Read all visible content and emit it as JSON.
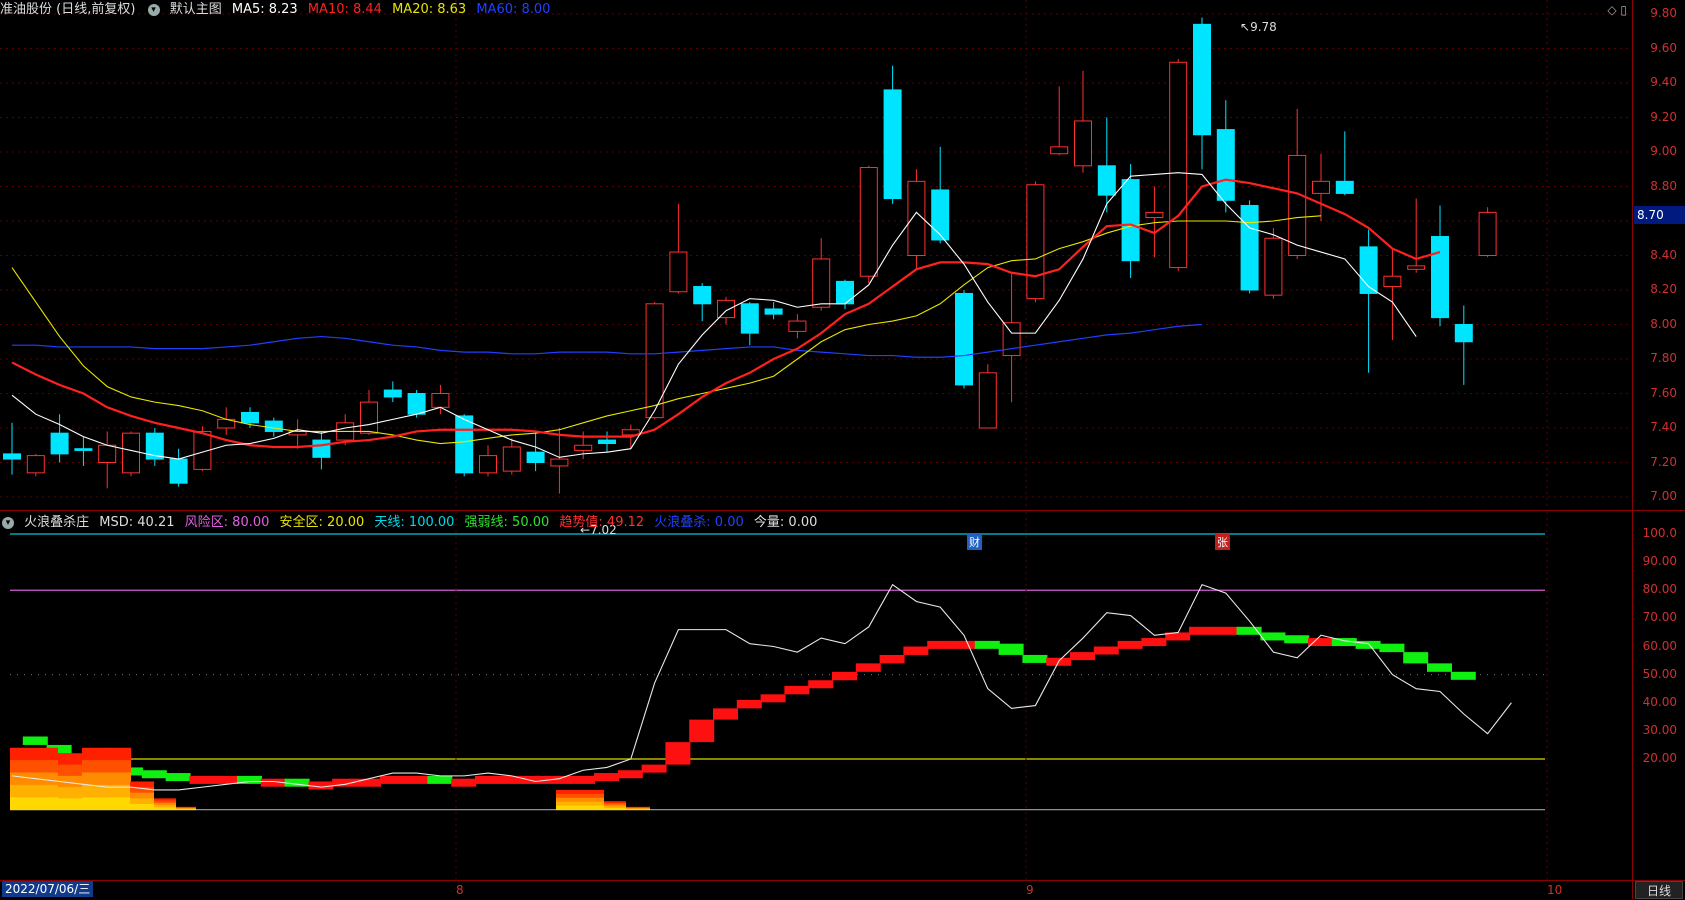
{
  "main_panel": {
    "stock_name": "准油股份 (日线,前复权)",
    "template_label": "默认主图",
    "ma5": "MA5: 8.23",
    "ma10": "MA10: 8.44",
    "ma20": "MA20: 8.63",
    "ma60": "MA60: 8.00",
    "high_marker": "9.78",
    "low_marker": "7.02",
    "event_badge_1": "财",
    "event_badge_2": "张",
    "price_box": "8.70",
    "price_axis_ticks": [
      "9.80",
      "9.60",
      "9.40",
      "9.20",
      "9.00",
      "8.80",
      "8.60",
      "8.40",
      "8.20",
      "8.00",
      "7.80",
      "7.60",
      "7.40",
      "7.20",
      "7.00"
    ],
    "colors": {
      "up": "#ff3030",
      "down": "#00e5ff",
      "ma5": "#ffffff",
      "ma10": "#ff2020",
      "ma20": "#e6e600",
      "ma60": "#2040ff"
    }
  },
  "indicator_panel": {
    "name": "火浪叠杀庄",
    "msd": "MSD: 40.21",
    "risk_zone": "风险区: 80.00",
    "safe_zone": "安全区: 20.00",
    "sky_line": "天线: 100.00",
    "strong_weak": "强弱线: 50.00",
    "trend_value": "趋势值: 49.12",
    "wave_kill": "火浪叠杀: 0.00",
    "volume": "今量: 0.00",
    "axis_ticks": [
      "100.0",
      "90.00",
      "80.00",
      "70.00",
      "60.00",
      "50.00",
      "40.00",
      "30.00",
      "20.00"
    ]
  },
  "bottom_bar": {
    "date": "2022/07/06/三",
    "month_8": "8",
    "month_9": "9",
    "month_10": "10",
    "period": "日线"
  },
  "chart_data": {
    "type": "candlestick",
    "ylim": [
      7.0,
      9.8
    ],
    "candles": [
      {
        "o": 7.25,
        "c": 7.22,
        "h": 7.43,
        "l": 7.13
      },
      {
        "o": 7.14,
        "c": 7.24,
        "h": 7.25,
        "l": 7.12
      },
      {
        "o": 7.37,
        "c": 7.25,
        "h": 7.48,
        "l": 7.2
      },
      {
        "o": 7.28,
        "c": 7.27,
        "h": 7.35,
        "l": 7.18
      },
      {
        "o": 7.2,
        "c": 7.3,
        "h": 7.38,
        "l": 7.05
      },
      {
        "o": 7.14,
        "c": 7.37,
        "h": 7.38,
        "l": 7.12
      },
      {
        "o": 7.37,
        "c": 7.22,
        "h": 7.4,
        "l": 7.18
      },
      {
        "o": 7.22,
        "c": 7.08,
        "h": 7.28,
        "l": 7.06
      },
      {
        "o": 7.16,
        "c": 7.38,
        "h": 7.41,
        "l": 7.15
      },
      {
        "o": 7.4,
        "c": 7.45,
        "h": 7.52,
        "l": 7.36
      },
      {
        "o": 7.49,
        "c": 7.43,
        "h": 7.52,
        "l": 7.4
      },
      {
        "o": 7.44,
        "c": 7.38,
        "h": 7.46,
        "l": 7.35
      },
      {
        "o": 7.36,
        "c": 7.38,
        "h": 7.45,
        "l": 7.28
      },
      {
        "o": 7.33,
        "c": 7.23,
        "h": 7.38,
        "l": 7.16
      },
      {
        "o": 7.33,
        "c": 7.43,
        "h": 7.48,
        "l": 7.3
      },
      {
        "o": 7.37,
        "c": 7.55,
        "h": 7.62,
        "l": 7.36
      },
      {
        "o": 7.62,
        "c": 7.58,
        "h": 7.67,
        "l": 7.55
      },
      {
        "o": 7.6,
        "c": 7.48,
        "h": 7.62,
        "l": 7.46
      },
      {
        "o": 7.52,
        "c": 7.6,
        "h": 7.65,
        "l": 7.48
      },
      {
        "o": 7.47,
        "c": 7.14,
        "h": 7.48,
        "l": 7.12
      },
      {
        "o": 7.14,
        "c": 7.24,
        "h": 7.3,
        "l": 7.12
      },
      {
        "o": 7.15,
        "c": 7.29,
        "h": 7.34,
        "l": 7.13
      },
      {
        "o": 7.26,
        "c": 7.2,
        "h": 7.38,
        "l": 7.15
      },
      {
        "o": 7.18,
        "c": 7.22,
        "h": 7.4,
        "l": 7.02
      },
      {
        "o": 7.27,
        "c": 7.3,
        "h": 7.38,
        "l": 7.22
      },
      {
        "o": 7.33,
        "c": 7.31,
        "h": 7.38,
        "l": 7.26
      },
      {
        "o": 7.36,
        "c": 7.39,
        "h": 7.42,
        "l": 7.28
      },
      {
        "o": 7.46,
        "c": 8.12,
        "h": 8.13,
        "l": 7.45
      },
      {
        "o": 8.19,
        "c": 8.42,
        "h": 8.7,
        "l": 8.18
      },
      {
        "o": 8.22,
        "c": 8.12,
        "h": 8.24,
        "l": 8.02
      },
      {
        "o": 8.04,
        "c": 8.14,
        "h": 8.16,
        "l": 8.0
      },
      {
        "o": 8.12,
        "c": 7.95,
        "h": 8.13,
        "l": 7.88
      },
      {
        "o": 8.09,
        "c": 8.06,
        "h": 8.13,
        "l": 8.03
      },
      {
        "o": 7.96,
        "c": 8.02,
        "h": 8.06,
        "l": 7.92
      },
      {
        "o": 8.1,
        "c": 8.38,
        "h": 8.5,
        "l": 8.08
      },
      {
        "o": 8.25,
        "c": 8.12,
        "h": 8.26,
        "l": 8.09
      },
      {
        "o": 8.28,
        "c": 8.91,
        "h": 8.92,
        "l": 8.24
      },
      {
        "o": 9.36,
        "c": 8.73,
        "h": 9.5,
        "l": 8.7
      },
      {
        "o": 8.4,
        "c": 8.83,
        "h": 8.9,
        "l": 8.32
      },
      {
        "o": 8.78,
        "c": 8.49,
        "h": 9.03,
        "l": 8.47
      },
      {
        "o": 8.18,
        "c": 7.65,
        "h": 8.2,
        "l": 7.63
      },
      {
        "o": 7.4,
        "c": 7.72,
        "h": 7.77,
        "l": 7.4
      },
      {
        "o": 7.82,
        "c": 8.01,
        "h": 8.3,
        "l": 7.55
      },
      {
        "o": 8.15,
        "c": 8.81,
        "h": 8.83,
        "l": 8.13
      },
      {
        "o": 8.99,
        "c": 9.03,
        "h": 9.38,
        "l": 8.98
      },
      {
        "o": 8.92,
        "c": 9.18,
        "h": 9.47,
        "l": 8.88
      },
      {
        "o": 8.92,
        "c": 8.75,
        "h": 9.2,
        "l": 8.65
      },
      {
        "o": 8.84,
        "c": 8.37,
        "h": 8.93,
        "l": 8.27
      },
      {
        "o": 8.62,
        "c": 8.65,
        "h": 8.8,
        "l": 8.39
      },
      {
        "o": 8.33,
        "c": 9.52,
        "h": 9.54,
        "l": 8.31
      },
      {
        "o": 9.74,
        "c": 9.1,
        "h": 9.78,
        "l": 8.9
      },
      {
        "o": 9.13,
        "c": 8.72,
        "h": 9.3,
        "l": 8.65
      },
      {
        "o": 8.69,
        "c": 8.2,
        "h": 8.72,
        "l": 8.18
      },
      {
        "o": 8.17,
        "c": 8.5,
        "h": 8.56,
        "l": 8.15
      },
      {
        "o": 8.4,
        "c": 8.98,
        "h": 9.25,
        "l": 8.38
      },
      {
        "o": 8.76,
        "c": 8.83,
        "h": 8.99,
        "l": 8.6
      },
      {
        "o": 8.83,
        "c": 8.76,
        "h": 9.12,
        "l": 8.75
      },
      {
        "o": 8.45,
        "c": 8.18,
        "h": 8.55,
        "l": 7.72
      },
      {
        "o": 8.22,
        "c": 8.28,
        "h": 8.44,
        "l": 7.91
      },
      {
        "o": 8.32,
        "c": 8.34,
        "h": 8.73,
        "l": 8.3
      },
      {
        "o": 8.51,
        "c": 8.04,
        "h": 8.69,
        "l": 7.99
      },
      {
        "o": 8.0,
        "c": 7.9,
        "h": 8.11,
        "l": 7.65
      },
      {
        "o": 8.4,
        "c": 8.65,
        "h": 8.68,
        "l": 8.39
      }
    ],
    "ma5": [
      7.59,
      7.48,
      7.42,
      7.35,
      7.3,
      7.27,
      7.24,
      7.22,
      7.26,
      7.3,
      7.31,
      7.34,
      7.39,
      7.37,
      7.4,
      7.42,
      7.45,
      7.48,
      7.52,
      7.45,
      7.39,
      7.33,
      7.29,
      7.23,
      7.25,
      7.26,
      7.28,
      7.5,
      7.77,
      7.94,
      8.08,
      8.15,
      8.14,
      8.1,
      8.12,
      8.12,
      8.23,
      8.46,
      8.65,
      8.52,
      8.35,
      8.13,
      7.95,
      7.95,
      8.14,
      8.38,
      8.7,
      8.86,
      8.87,
      8.88,
      8.87,
      8.7,
      8.56,
      8.52,
      8.46,
      8.42,
      8.38,
      8.22,
      8.13,
      7.93
    ],
    "ma10": [
      7.78,
      7.71,
      7.65,
      7.6,
      7.52,
      7.47,
      7.43,
      7.4,
      7.37,
      7.33,
      7.3,
      7.29,
      7.29,
      7.3,
      7.32,
      7.33,
      7.35,
      7.38,
      7.39,
      7.39,
      7.39,
      7.39,
      7.38,
      7.36,
      7.35,
      7.35,
      7.35,
      7.39,
      7.48,
      7.58,
      7.66,
      7.72,
      7.8,
      7.86,
      7.95,
      8.06,
      8.12,
      8.22,
      8.32,
      8.36,
      8.36,
      8.35,
      8.3,
      8.28,
      8.32,
      8.45,
      8.57,
      8.58,
      8.53,
      8.63,
      8.8,
      8.84,
      8.82,
      8.79,
      8.76,
      8.7,
      8.64,
      8.56,
      8.44,
      8.38,
      8.42
    ],
    "ma20": [
      8.33,
      8.13,
      7.93,
      7.76,
      7.64,
      7.58,
      7.55,
      7.53,
      7.5,
      7.45,
      7.42,
      7.4,
      7.38,
      7.38,
      7.38,
      7.38,
      7.36,
      7.33,
      7.31,
      7.32,
      7.34,
      7.36,
      7.37,
      7.39,
      7.43,
      7.47,
      7.5,
      7.53,
      7.57,
      7.6,
      7.63,
      7.66,
      7.7,
      7.8,
      7.9,
      7.97,
      8.0,
      8.02,
      8.05,
      8.12,
      8.23,
      8.33,
      8.37,
      8.38,
      8.44,
      8.48,
      8.53,
      8.57,
      8.59,
      8.6,
      8.6,
      8.6,
      8.59,
      8.6,
      8.62,
      8.63
    ],
    "ma60": [
      7.88,
      7.88,
      7.87,
      7.87,
      7.87,
      7.87,
      7.86,
      7.86,
      7.86,
      7.87,
      7.88,
      7.9,
      7.92,
      7.93,
      7.92,
      7.9,
      7.88,
      7.87,
      7.85,
      7.84,
      7.84,
      7.83,
      7.83,
      7.84,
      7.84,
      7.84,
      7.83,
      7.83,
      7.84,
      7.85,
      7.86,
      7.87,
      7.87,
      7.85,
      7.84,
      7.83,
      7.82,
      7.82,
      7.81,
      7.81,
      7.82,
      7.84,
      7.86,
      7.88,
      7.9,
      7.92,
      7.94,
      7.95,
      7.97,
      7.99,
      8.0
    ],
    "msd": [
      14,
      13,
      12,
      11,
      10,
      10,
      9,
      9,
      10,
      11,
      12,
      12,
      11,
      10,
      11,
      13,
      15,
      15,
      14,
      14,
      15,
      14,
      12,
      13,
      16,
      17,
      20,
      47,
      66,
      66,
      66,
      61,
      60,
      58,
      63,
      61,
      67,
      82,
      76,
      74,
      64,
      45,
      38,
      39,
      55,
      63,
      72,
      71,
      64,
      65,
      82,
      79,
      69,
      58,
      56,
      64,
      62,
      61,
      50,
      45,
      44,
      36,
      29,
      40
    ],
    "trend": [
      28,
      25,
      22,
      20,
      17,
      16,
      15,
      14,
      14,
      14,
      13,
      13,
      12,
      12,
      13,
      13,
      14,
      14,
      13,
      13,
      14,
      14,
      14,
      14,
      14,
      15,
      16,
      18,
      26,
      34,
      38,
      41,
      43,
      46,
      48,
      51,
      54,
      57,
      60,
      62,
      62,
      61,
      57,
      55,
      56,
      58,
      60,
      62,
      63,
      65,
      67,
      67,
      65,
      64,
      63,
      63,
      62,
      61,
      58,
      54,
      51,
      49
    ],
    "ylim_indicator": [
      0,
      100
    ]
  }
}
